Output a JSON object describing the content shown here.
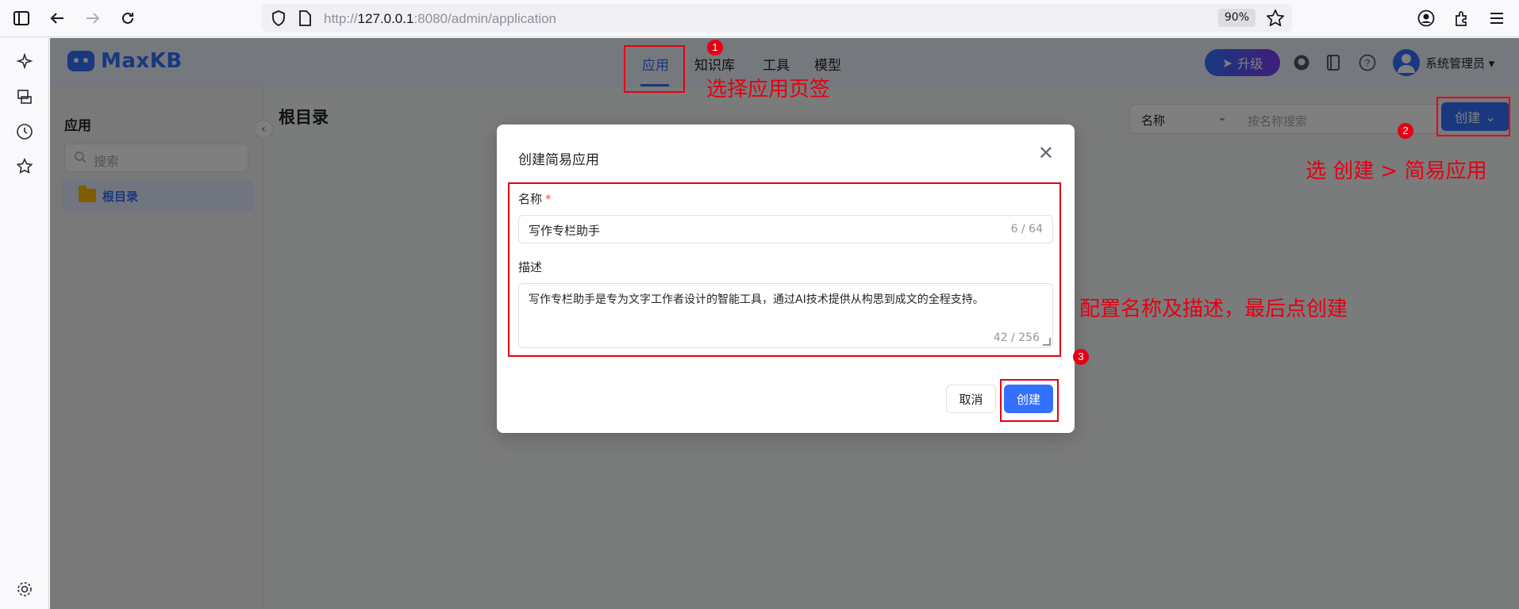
{
  "browser": {
    "url_prefix": "http://",
    "url_host": "127.0.0.1",
    "url_rest": ":8080/admin/application",
    "zoom": "90%"
  },
  "header": {
    "logo": "MaxKB",
    "tabs": [
      "应用",
      "知识库",
      "工具",
      "模型"
    ],
    "upgrade_label": "升级",
    "user_name": "系统管理员"
  },
  "left_panel": {
    "title": "应用",
    "search_placeholder": "搜索",
    "root_folder": "根目录"
  },
  "main": {
    "title": "根目录",
    "filter_select": "名称",
    "filter_placeholder": "按名称搜索",
    "create_label": "创建"
  },
  "dialog": {
    "title": "创建简易应用",
    "name_label": "名称",
    "required_mark": "*",
    "name_value": "写作专栏助手",
    "name_count": "6 / 64",
    "desc_label": "描述",
    "desc_value": "写作专栏助手是专为文字工作者设计的智能工具，通过AI技术提供从构思到成文的全程支持。",
    "desc_count": "42 / 256",
    "cancel_label": "取消",
    "confirm_label": "创建"
  },
  "annotations": {
    "step1_num": "1",
    "step1_text": "选择应用页签",
    "step2_num": "2",
    "step2_text": "选 创建 > 简易应用",
    "step3_num": "3",
    "step3_text": "配置名称及描述，最后点创建"
  },
  "colors": {
    "accent": "#3370ff",
    "annotation": "#e60012"
  }
}
